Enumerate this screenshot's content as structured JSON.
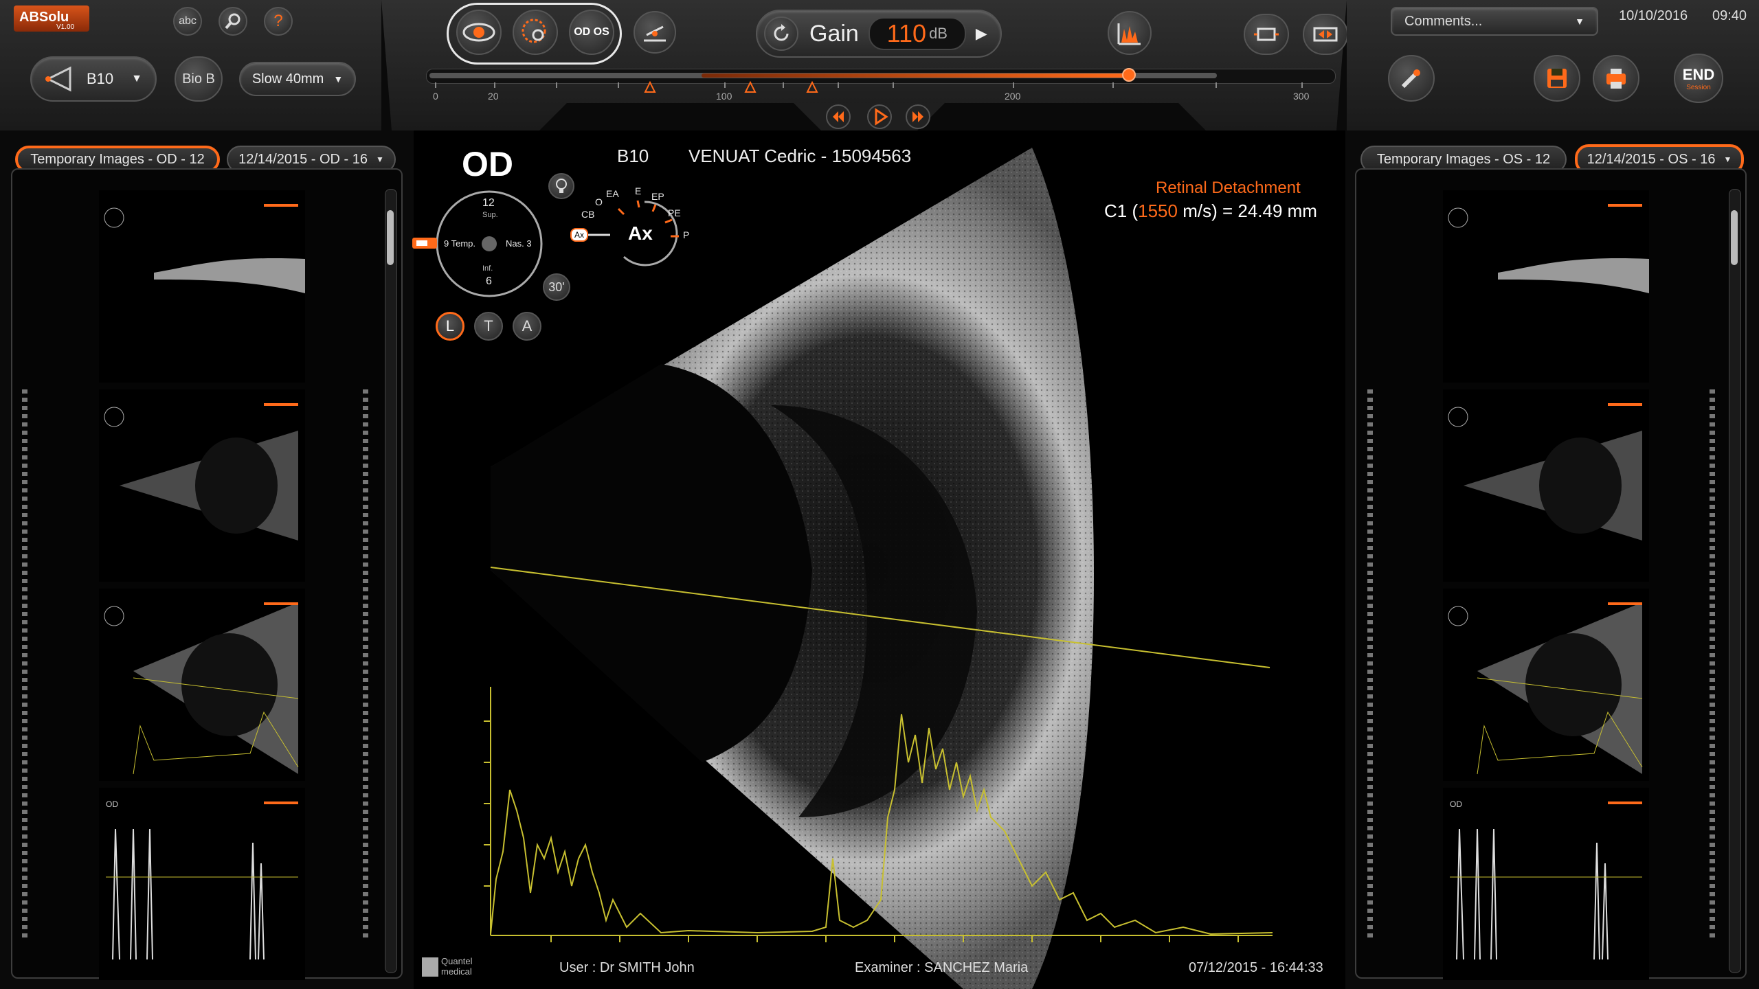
{
  "app": {
    "logo": "ABSolu",
    "version": "V1.00"
  },
  "topleft": {
    "abc_label": "abc",
    "help_label": "?"
  },
  "probe": {
    "selected": "B10",
    "bio_label": "Bio B",
    "speed_label": "Slow 40mm"
  },
  "center_toolbar": {
    "od_os_label": "OD OS",
    "gain_label": "Gain",
    "gain_value": "110",
    "gain_unit": "dB",
    "scale_ticks": [
      "0",
      "20",
      "100",
      "200",
      "300"
    ],
    "gain_slider_fraction": 0.86
  },
  "right_toolbar": {
    "comments_placeholder": "Comments...",
    "date": "10/10/2016",
    "time": "09:40",
    "end_label": "END",
    "end_sub": "Session"
  },
  "left_panel": {
    "tab_temp": "Temporary Images - OD - 12",
    "tab_date": "12/14/2015 - OD - 16"
  },
  "right_panel": {
    "tab_temp": "Temporary Images - OS - 12",
    "tab_date": "12/14/2015 - OS - 16"
  },
  "main": {
    "eye": "OD",
    "probe": "B10",
    "patient": "VENUAT Cedric - 15094563",
    "diagnosis": "Retinal Detachment",
    "measure_prefix": "C1 (",
    "measure_speed": "1550",
    "measure_suffix": " m/s) = 24.49 mm",
    "clock": {
      "top": "12",
      "top_sub": "Sup.",
      "bottom": "6",
      "bottom_sub": "Inf.",
      "left": "9 Temp.",
      "right": "Nas. 3"
    },
    "angle": "30'",
    "axial": {
      "center": "Ax",
      "labels": [
        "EA",
        "E",
        "EP",
        "PE",
        "P",
        "O",
        "CB",
        "Ax"
      ]
    },
    "ltA": [
      "L",
      "T",
      "A"
    ],
    "user": "User : Dr SMITH John",
    "examiner": "Examiner : SANCHEZ Maria",
    "timestamp": "07/12/2015 - 16:44:33",
    "brand": "Quantel medical"
  },
  "colors": {
    "accent": "#ff6a1a",
    "trace": "#c8c030"
  }
}
